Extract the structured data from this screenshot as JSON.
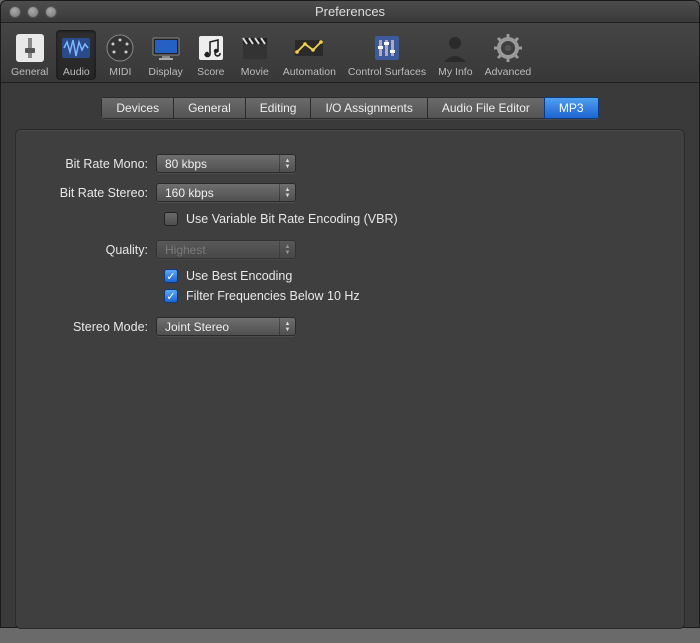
{
  "window": {
    "title": "Preferences"
  },
  "toolbar": {
    "items": [
      {
        "label": "General"
      },
      {
        "label": "Audio"
      },
      {
        "label": "MIDI"
      },
      {
        "label": "Display"
      },
      {
        "label": "Score"
      },
      {
        "label": "Movie"
      },
      {
        "label": "Automation"
      },
      {
        "label": "Control Surfaces"
      },
      {
        "label": "My Info"
      },
      {
        "label": "Advanced"
      }
    ],
    "selected": 1
  },
  "tabs": {
    "items": [
      "Devices",
      "General",
      "Editing",
      "I/O Assignments",
      "Audio File Editor",
      "MP3"
    ],
    "selected": 5
  },
  "form": {
    "bitrate_mono": {
      "label": "Bit Rate Mono:",
      "value": "80 kbps"
    },
    "bitrate_stereo": {
      "label": "Bit Rate Stereo:",
      "value": "160 kbps"
    },
    "vbr": {
      "label": "Use Variable Bit Rate Encoding (VBR)",
      "checked": false
    },
    "quality": {
      "label": "Quality:",
      "value": "Highest",
      "disabled": true
    },
    "best_encoding": {
      "label": "Use Best Encoding",
      "checked": true
    },
    "filter_freq": {
      "label": "Filter Frequencies Below 10 Hz",
      "checked": true
    },
    "stereo_mode": {
      "label": "Stereo Mode:",
      "value": "Joint Stereo"
    }
  }
}
